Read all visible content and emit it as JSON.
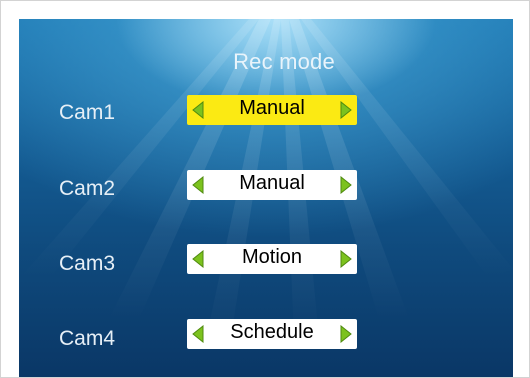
{
  "screen": {
    "title": "Rec mode"
  },
  "cameras": [
    {
      "label": "Cam1",
      "mode": "Manual",
      "selected": true
    },
    {
      "label": "Cam2",
      "mode": "Manual",
      "selected": false
    },
    {
      "label": "Cam3",
      "mode": "Motion",
      "selected": false
    },
    {
      "label": "Cam4",
      "mode": "Schedule",
      "selected": false
    }
  ],
  "icons": {
    "left": "arrow-left-icon",
    "right": "arrow-right-icon"
  },
  "colors": {
    "selected_background": "#fbea13",
    "selector_background": "#ffffff",
    "arrow_green": "#7cc21e"
  }
}
